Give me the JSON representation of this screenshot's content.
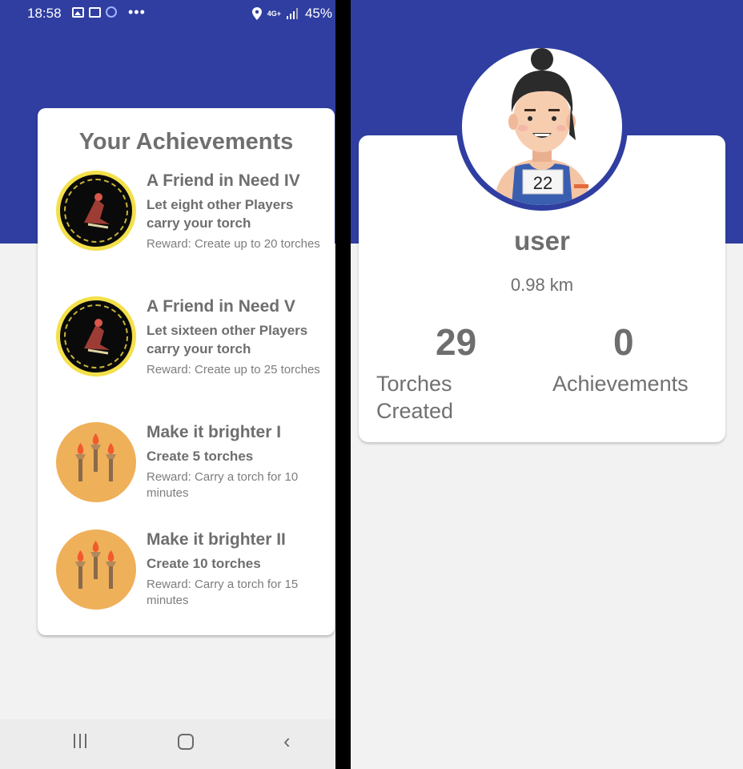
{
  "status_bar": {
    "time": "18:58",
    "battery": "45%",
    "network": "4G+"
  },
  "achievements": {
    "title": "Your Achievements",
    "items": [
      {
        "name": "A Friend in Need IV",
        "desc": "Let eight other Players carry your torch",
        "reward": "Reward: Create up to 20 torches",
        "badge": "friend-badge-icon"
      },
      {
        "name": "A Friend in Need V",
        "desc": "Let sixteen other Players carry your torch",
        "reward": "Reward: Create up to 25 torches",
        "badge": "friend-badge-icon"
      },
      {
        "name": "Make it brighter I",
        "desc": "Create 5 torches",
        "reward": "Reward: Carry a torch for 10 minutes",
        "badge": "torches-badge-icon"
      },
      {
        "name": "Make it brighter II",
        "desc": "Create 10 torches",
        "reward": "Reward: Carry a torch for 15 minutes",
        "badge": "torches-badge-icon"
      }
    ]
  },
  "profile": {
    "username": "user",
    "distance": "0.98 km",
    "bib_number": "22",
    "stats": {
      "torches_value": "29",
      "torches_label": "Torches Created",
      "achievements_value": "0",
      "achievements_label": "Achievements"
    }
  },
  "colors": {
    "header_blue": "#2f3ea0",
    "badge_yellow": "#f3e04a",
    "badge_orange": "#efb05a"
  }
}
